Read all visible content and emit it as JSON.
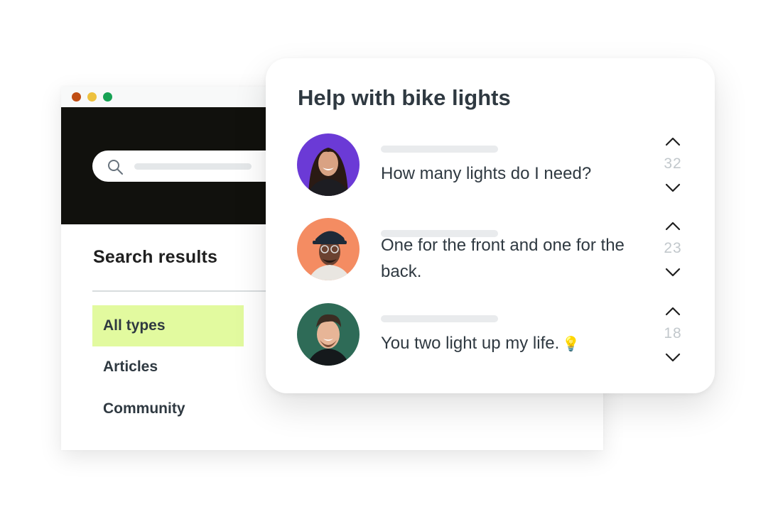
{
  "search_page": {
    "results_title": "Search results",
    "filters": [
      {
        "label": "All types",
        "active": true
      },
      {
        "label": "Articles",
        "active": false
      },
      {
        "label": "Community",
        "active": false
      }
    ]
  },
  "card": {
    "title": "Help with bike lights",
    "posts": [
      {
        "text": "How many lights do I need?",
        "votes": "32",
        "avatar_bg": "#6b3ad6"
      },
      {
        "text": "One for the front and one for the back.",
        "votes": "23",
        "avatar_bg": "#f48c62"
      },
      {
        "text": "You two light up my life.",
        "emoji": "💡",
        "votes": "18",
        "avatar_bg": "#2e6b57"
      }
    ]
  },
  "colors": {
    "hero_bg": "#11110d",
    "active_filter_bg": "#e2fa9f",
    "window_dots": [
      "#c04e14",
      "#edc13e",
      "#17a254"
    ]
  }
}
